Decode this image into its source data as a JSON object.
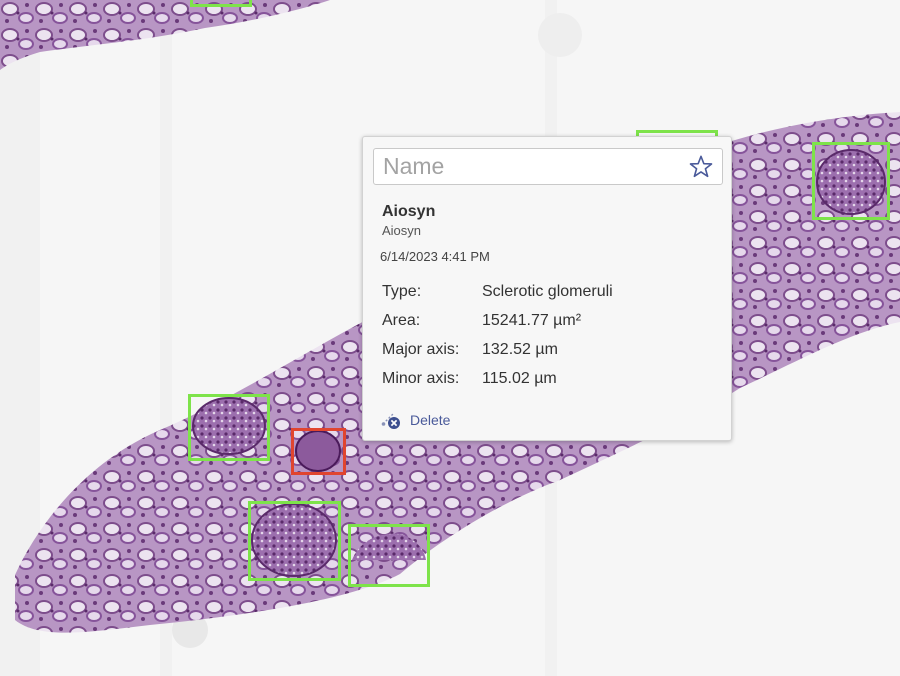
{
  "popup": {
    "name_placeholder": "Name",
    "name_value": "",
    "author_name": "Aiosyn",
    "author_org": "Aiosyn",
    "timestamp": "6/14/2023 4:41 PM",
    "properties": [
      {
        "label": "Type:",
        "value": "Sclerotic glomeruli"
      },
      {
        "label": "Area:",
        "value": "15241.77 µm²"
      },
      {
        "label": "Major axis:",
        "value": "132.52 µm"
      },
      {
        "label": "Minor axis:",
        "value": "115.02 µm"
      }
    ],
    "delete_label": "Delete"
  },
  "icons": {
    "favorite": "star-icon",
    "delete": "delete-icon"
  },
  "colors": {
    "glomerulus_outline": "#7ee34a",
    "sclerotic_outline": "#e0452f",
    "tissue": "#b58cbf",
    "link": "#4a5a9a"
  }
}
